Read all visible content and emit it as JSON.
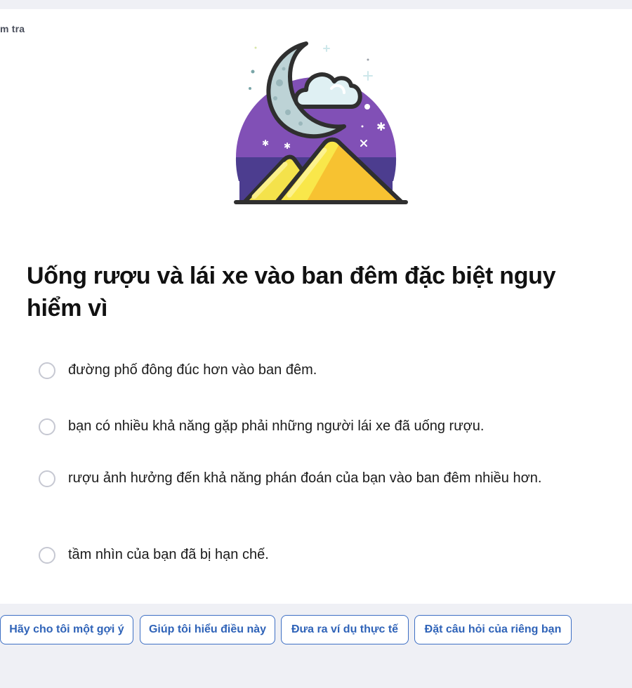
{
  "breadcrumb": {
    "text": "m tra"
  },
  "illustration": {
    "icon": "night-mountain-moon-cloud-icon"
  },
  "question": {
    "text": "Uống rượu và lái xe vào ban đêm đặc biệt nguy hiểm vì"
  },
  "options": [
    {
      "label": "đường phố đông đúc hơn vào ban đêm.",
      "selected": false
    },
    {
      "label": "bạn có nhiều khả năng gặp phải những người lái xe đã uống rượu.",
      "selected": false
    },
    {
      "label": "rượu ảnh hưởng đến khả năng phán đoán của bạn vào ban đêm nhiều hơn.",
      "selected": false
    },
    {
      "label": "tầm nhìn của bạn đã bị hạn chế.",
      "selected": false
    }
  ],
  "actions": [
    {
      "label": "Hãy cho tôi một gợi ý"
    },
    {
      "label": "Giúp tôi hiểu điều này"
    },
    {
      "label": "Đưa ra ví dụ thực tế"
    },
    {
      "label": "Đặt câu hỏi của riêng bạn"
    }
  ],
  "colors": {
    "page_background": "#eff0f5",
    "card_background": "#ffffff",
    "button_accent": "#2f63b8",
    "radio_border": "#c6c8d2",
    "illustration_purple": "#7e52b4",
    "illustration_yellow": "#f7c231"
  }
}
